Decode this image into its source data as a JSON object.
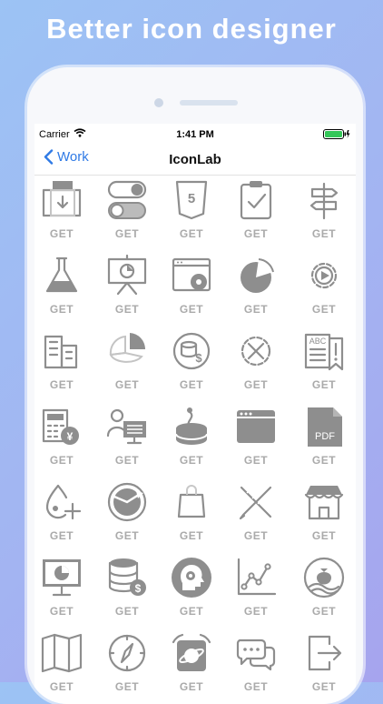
{
  "headline": "Better icon designer",
  "status": {
    "carrier": "Carrier",
    "time": "1:41 PM"
  },
  "nav": {
    "back_label": "Work",
    "title": "IconLab"
  },
  "get_label": "GET",
  "icons": [
    "download-box-icon",
    "toggle-switches-icon",
    "html5-icon",
    "clipboard-check-icon",
    "signpost-icon",
    "flask-icon",
    "presentation-chart-icon",
    "browser-settings-icon",
    "pie-chart-icon",
    "gear-play-icon",
    "buildings-icon",
    "pie-chart-3d-icon",
    "coins-dollar-icon",
    "settings-tools-icon",
    "abc-book-icon",
    "calculator-yen-icon",
    "user-desktop-icon",
    "database-pin-icon",
    "browser-window-icon",
    "pdf-file-icon",
    "drop-plus-icon",
    "globe-plane-icon",
    "shopping-bag-icon",
    "pencil-ruler-icon",
    "store-icon",
    "monitor-chart-icon",
    "database-dollar-icon",
    "head-gears-icon",
    "line-chart-icon",
    "money-bag-icon",
    "map-book-icon",
    "compass-icon",
    "planet-app-icon",
    "chat-bubbles-icon",
    "exit-icon"
  ],
  "colors": {
    "icon": "#8e8e8e",
    "get": "#aaaaaa",
    "back": "#2f7ae5",
    "battery": "#34c759"
  }
}
